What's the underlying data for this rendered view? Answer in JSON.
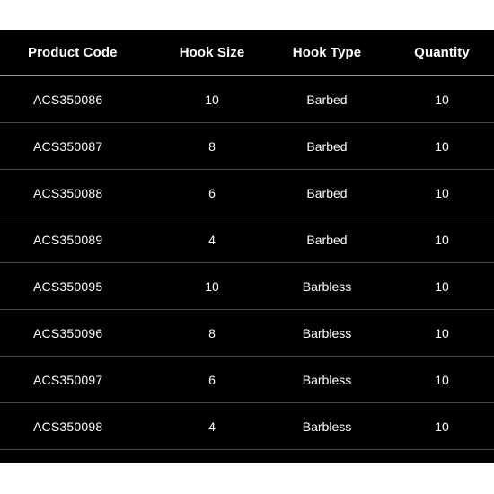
{
  "table": {
    "name": "hook-specification-table",
    "background_color": "#000000",
    "text_color": "#ffffff",
    "header_rule_color": "#9a9a9a",
    "row_rule_color": "#4a4a4a",
    "page_background_color": "#ffffff",
    "columns": [
      {
        "key": "product_code",
        "label": "Product Code",
        "align": "left"
      },
      {
        "key": "hook_size",
        "label": "Hook Size",
        "align": "center"
      },
      {
        "key": "hook_type",
        "label": "Hook Type",
        "align": "center"
      },
      {
        "key": "quantity",
        "label": "Quantity",
        "align": "center"
      }
    ],
    "rows": [
      {
        "product_code": "ACS350086",
        "hook_size": "10",
        "hook_type": "Barbed",
        "quantity": "10"
      },
      {
        "product_code": "ACS350087",
        "hook_size": "8",
        "hook_type": "Barbed",
        "quantity": "10"
      },
      {
        "product_code": "ACS350088",
        "hook_size": "6",
        "hook_type": "Barbed",
        "quantity": "10"
      },
      {
        "product_code": "ACS350089",
        "hook_size": "4",
        "hook_type": "Barbed",
        "quantity": "10"
      },
      {
        "product_code": "ACS350095",
        "hook_size": "10",
        "hook_type": "Barbless",
        "quantity": "10"
      },
      {
        "product_code": "ACS350096",
        "hook_size": "8",
        "hook_type": "Barbless",
        "quantity": "10"
      },
      {
        "product_code": "ACS350097",
        "hook_size": "6",
        "hook_type": "Barbless",
        "quantity": "10"
      },
      {
        "product_code": "ACS350098",
        "hook_size": "4",
        "hook_type": "Barbless",
        "quantity": "10"
      }
    ]
  }
}
